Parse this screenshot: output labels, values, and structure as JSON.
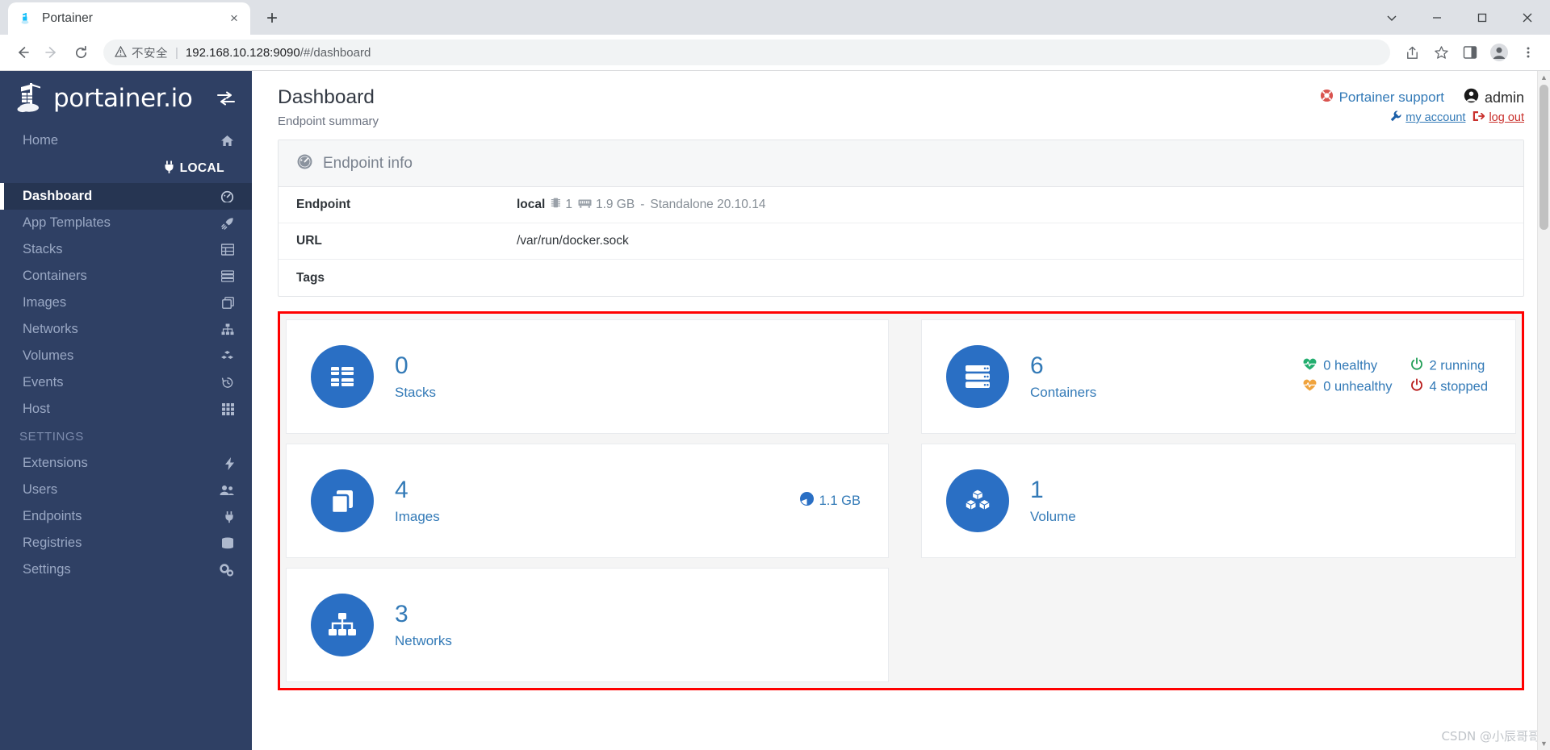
{
  "browser": {
    "tab": {
      "title": "Portainer",
      "favicon": "portainer-favicon",
      "close_label": "×"
    },
    "new_tab_label": "+",
    "window_controls": {
      "minimize": "–",
      "maximize": "□",
      "close": "✕",
      "more": "⌄"
    },
    "nav": {
      "back": "←",
      "forward": "→",
      "reload": "↻"
    },
    "omnibox": {
      "warning_icon": "warning-triangle-icon",
      "warning_text": "不安全",
      "separator": "|",
      "url_host": "192.168.10.128:9090",
      "url_path": "/#/dashboard"
    },
    "toolbar_icons": [
      "share-icon",
      "bookmark-star-icon",
      "side-panel-icon",
      "profile-icon",
      "more-menu-icon"
    ]
  },
  "sidebar": {
    "brand": {
      "text": "portainer.io",
      "logo": "portainer-logo",
      "toggle_icon": "collapse-sidebar-icon"
    },
    "home": {
      "label": "Home",
      "icon": "home-icon"
    },
    "environment": {
      "label": "LOCAL",
      "icon": "plug-icon"
    },
    "items": [
      {
        "label": "Dashboard",
        "icon": "dashboard-icon",
        "active": true
      },
      {
        "label": "App Templates",
        "icon": "rocket-icon",
        "active": false
      },
      {
        "label": "Stacks",
        "icon": "stacks-icon",
        "active": false
      },
      {
        "label": "Containers",
        "icon": "containers-icon",
        "active": false
      },
      {
        "label": "Images",
        "icon": "images-icon",
        "active": false
      },
      {
        "label": "Networks",
        "icon": "networks-icon",
        "active": false
      },
      {
        "label": "Volumes",
        "icon": "volumes-icon",
        "active": false
      },
      {
        "label": "Events",
        "icon": "history-clock-icon",
        "active": false
      },
      {
        "label": "Host",
        "icon": "host-grid-icon",
        "active": false
      }
    ],
    "settings_section": "SETTINGS",
    "settings_items": [
      {
        "label": "Extensions",
        "icon": "bolt-icon"
      },
      {
        "label": "Users",
        "icon": "users-icon"
      },
      {
        "label": "Endpoints",
        "icon": "plug-icon"
      },
      {
        "label": "Registries",
        "icon": "registries-icon"
      },
      {
        "label": "Settings",
        "icon": "gears-icon"
      }
    ]
  },
  "header": {
    "title": "Dashboard",
    "subtitle": "Endpoint summary",
    "support_label": "Portainer support",
    "support_icon": "lifebuoy-icon",
    "user_name": "admin",
    "user_icon": "user-circle-icon",
    "my_account_label": "my account",
    "my_account_icon": "wrench-icon",
    "log_out_label": "log out",
    "log_out_icon": "sign-out-icon"
  },
  "endpoint_info": {
    "panel_title": "Endpoint info",
    "panel_icon": "tachometer-icon",
    "rows": [
      {
        "label": "Endpoint",
        "name": "local",
        "cpu_icon": "cpu-icon",
        "cpu": "1",
        "memory_icon": "memory-icon",
        "memory": "1.9 GB",
        "separator": "-",
        "mode": "Standalone 20.10.14"
      },
      {
        "label": "URL",
        "value": "/var/run/docker.sock"
      },
      {
        "label": "Tags",
        "value": ""
      }
    ]
  },
  "dashboard_cards": {
    "stacks": {
      "count": "0",
      "label": "Stacks",
      "icon": "stacks-card-icon"
    },
    "images": {
      "count": "4",
      "label": "Images",
      "icon": "images-card-icon",
      "size": "1.1 GB",
      "size_icon": "pie-chart-icon"
    },
    "networks": {
      "count": "3",
      "label": "Networks",
      "icon": "networks-card-icon"
    },
    "containers": {
      "count": "6",
      "label": "Containers",
      "icon": "containers-card-icon",
      "stats": [
        {
          "icon": "heartbeat-green-icon",
          "text": "0 healthy",
          "color": "#23ae6f"
        },
        {
          "icon": "power-green-icon",
          "text": "2 running",
          "color": "#1f9d55"
        },
        {
          "icon": "heartbeat-orange-icon",
          "text": "0 unhealthy",
          "color": "#f0a33c"
        },
        {
          "icon": "power-red-icon",
          "text": "4 stopped",
          "color": "#b81a1a"
        }
      ]
    },
    "volumes": {
      "count": "1",
      "label": "Volume",
      "icon": "volumes-card-icon"
    }
  },
  "watermark": "CSDN @小辰哥哥",
  "colors": {
    "sidebar_bg": "#2f4064",
    "sidebar_active_bg": "#263552",
    "accent_blue": "#337ab7",
    "badge_blue": "#2a6fc4",
    "highlight_red": "#ff0000"
  }
}
